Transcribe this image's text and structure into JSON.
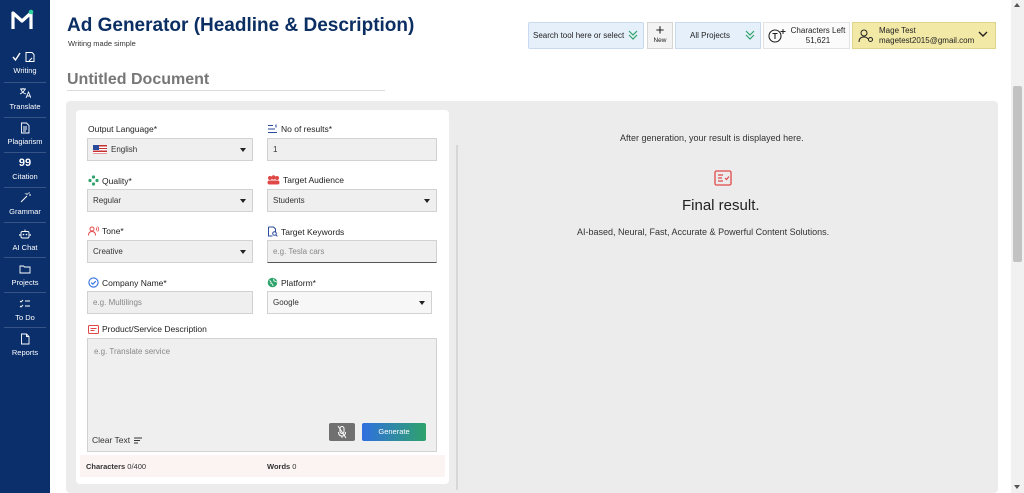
{
  "sidebar": {
    "items": [
      {
        "label": "Writing",
        "icon": "edit-icon"
      },
      {
        "label": "Translate",
        "icon": "translate-icon"
      },
      {
        "label": "Plagiarism",
        "icon": "document-icon"
      },
      {
        "label": "Citation",
        "icon": "quote-icon"
      },
      {
        "label": "Grammar",
        "icon": "magic-wand-icon"
      },
      {
        "label": "AI Chat",
        "icon": "robot-icon"
      },
      {
        "label": "Projects",
        "icon": "folder-icon"
      },
      {
        "label": "To Do",
        "icon": "checklist-icon"
      },
      {
        "label": "Reports",
        "icon": "report-icon"
      }
    ]
  },
  "header": {
    "title": "Ad Generator (Headline & Description)",
    "subtitle": "Writing made simple",
    "doc_title": "Untitled Document",
    "search_label": "Search tool here or select",
    "new_label": "New",
    "projects_label": "All Projects",
    "chars_left_label": "Characters Left",
    "chars_left_value": "51,621",
    "user_name": "Mage Test",
    "user_email": "magetest2015@gmail.com"
  },
  "form": {
    "output_language": {
      "label": "Output Language*",
      "value": "English"
    },
    "num_results": {
      "label": "No of results*",
      "value": "1"
    },
    "quality": {
      "label": "Quality*",
      "value": "Regular"
    },
    "target_audience": {
      "label": "Target Audience",
      "value": "Students"
    },
    "tone": {
      "label": "Tone*",
      "value": "Creative"
    },
    "target_keywords": {
      "label": "Target Keywords",
      "placeholder": "e.g. Tesla cars"
    },
    "company_name": {
      "label": "Company Name*",
      "placeholder": "e.g. Multilings"
    },
    "platform": {
      "label": "Platform*",
      "value": "Google"
    },
    "description": {
      "label": "Product/Service Description",
      "placeholder": "e.g. Translate service"
    },
    "clear_text": "Clear Text",
    "generate": "Generate",
    "characters_label": "Characters",
    "characters_value": "0/400",
    "words_label": "Words",
    "words_value": "0"
  },
  "result": {
    "hint": "After generation, your result is displayed here.",
    "title": "Final result.",
    "subtitle": "AI-based, Neural, Fast, Accurate & Powerful Content Solutions."
  },
  "colors": {
    "sidebar": "#0a2f6b",
    "title": "#0b2e63",
    "accent_red": "#e04848",
    "accent_green": "#2fa36b",
    "accent_blue": "#2f6fe0",
    "user_box": "#f3e9a6"
  }
}
